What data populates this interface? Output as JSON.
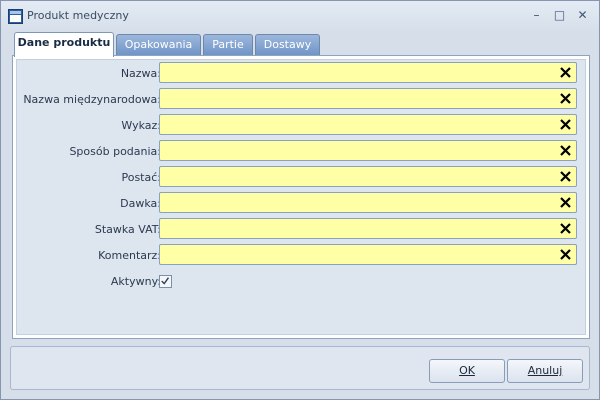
{
  "window": {
    "title": "Produkt medyczny",
    "minimize_glyph": "–",
    "maximize_glyph": "□",
    "close_glyph": "✕"
  },
  "tabs": [
    {
      "label": "Dane produktu",
      "active": true
    },
    {
      "label": "Opakowania",
      "active": false
    },
    {
      "label": "Partie",
      "active": false
    },
    {
      "label": "Dostawy",
      "active": false
    }
  ],
  "form": {
    "fields": [
      {
        "label": "Nazwa:",
        "value": ""
      },
      {
        "label": "Nazwa międzynarodowa:",
        "value": ""
      },
      {
        "label": "Wykaz:",
        "value": ""
      },
      {
        "label": "Sposób podania:",
        "value": ""
      },
      {
        "label": "Postać:",
        "value": ""
      },
      {
        "label": "Dawka:",
        "value": ""
      },
      {
        "label": "Stawka VAT:",
        "value": ""
      },
      {
        "label": "Komentarz:",
        "value": ""
      }
    ],
    "active_label": "Aktywny:",
    "active_checked": true,
    "input_bg_color": "#ffffa6"
  },
  "buttons": {
    "ok": "OK",
    "cancel": "Anuluj"
  },
  "icons": {
    "window": "app-window-icon",
    "clear": "clear-x-icon",
    "check": "checkmark-icon"
  }
}
